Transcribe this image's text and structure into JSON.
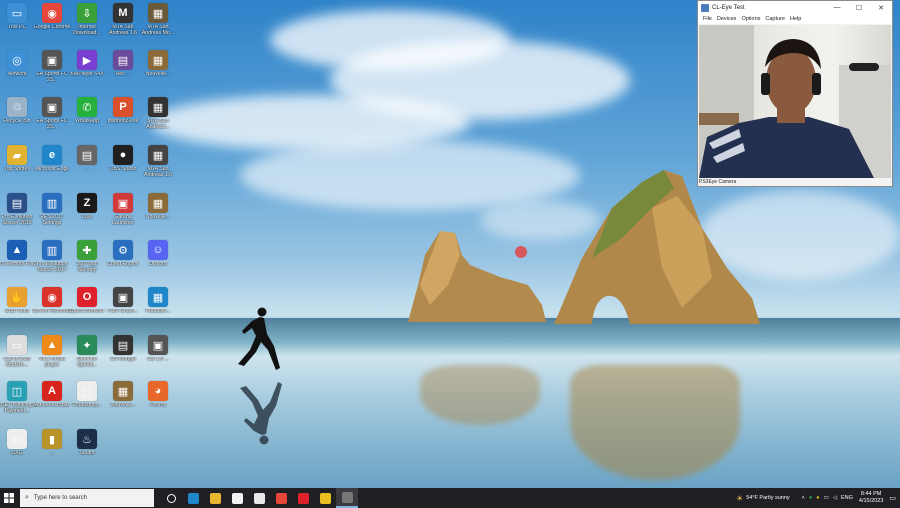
{
  "desktop_icons": [
    {
      "label": "This PC",
      "color": "#3d8fd6",
      "glyph": "▭"
    },
    {
      "label": "Google Chrome",
      "color": "#e6473a",
      "glyph": "◉"
    },
    {
      "label": "Internet Download...",
      "color": "#3aa13a",
      "glyph": "⇩"
    },
    {
      "label": "MTA San Andreas 1.6",
      "color": "#333333",
      "glyph": "M"
    },
    {
      "label": "MTA San Andreas Mo...",
      "color": "#6b5a3a",
      "glyph": "▦"
    },
    {
      "label": "Network",
      "color": "#3d8fd6",
      "glyph": "◎"
    },
    {
      "label": "EA Sports FC 23...",
      "color": "#555555",
      "glyph": "▣"
    },
    {
      "label": "KMPlayer 64X",
      "color": "#7a3fd1",
      "glyph": "▶"
    },
    {
      "label": "Rec ...",
      "color": "#6a4a9a",
      "glyph": "▤"
    },
    {
      "label": "Nouvelle...",
      "color": "#8b6b3a",
      "glyph": "▦"
    },
    {
      "label": "Recycle Bin",
      "color": "#9ab3c9",
      "glyph": "♲"
    },
    {
      "label": "EA Sports FC 23...",
      "color": "#555555",
      "glyph": "▣"
    },
    {
      "label": "WhatsApp",
      "color": "#25b13c",
      "glyph": "✆"
    },
    {
      "label": "psiphon3.exe",
      "color": "#d9502a",
      "glyph": "P"
    },
    {
      "label": "MTA San Andreas...",
      "color": "#333333",
      "glyph": "▦"
    },
    {
      "label": "Top Sprites",
      "color": "#e0b430",
      "glyph": "▰"
    },
    {
      "label": "Microsoft Edge",
      "color": "#1f86c9",
      "glyph": "e"
    },
    {
      "label": "...",
      "color": "#666666",
      "glyph": "▤"
    },
    {
      "label": "OBS Studio",
      "color": "#202020",
      "glyph": "●"
    },
    {
      "label": "MTA San Andreas 1.6",
      "color": "#444444",
      "glyph": "▦"
    },
    {
      "label": "Pro Evolution Soccer 2019",
      "color": "#2a4f8a",
      "glyph": "▤"
    },
    {
      "label": "PES 2017 Settings",
      "color": "#2a6fbf",
      "glyph": "▥"
    },
    {
      "label": "Zula",
      "color": "#1a1a1a",
      "glyph": "Z"
    },
    {
      "label": "Garena Launcher",
      "color": "#d23a3a",
      "glyph": "▣"
    },
    {
      "label": "Nouvelle...",
      "color": "#8b6b3a",
      "glyph": "▦"
    },
    {
      "label": "PS Remote Play",
      "color": "#1b5fb4",
      "glyph": "▲"
    },
    {
      "label": "Pro Evolution Soccer 2017",
      "color": "#2a6fbf",
      "glyph": "▥"
    },
    {
      "label": "360 Total Security",
      "color": "#3aa13a",
      "glyph": "✚"
    },
    {
      "label": "Cheat Engine",
      "color": "#2a6fbf",
      "glyph": "⚙"
    },
    {
      "label": "Discord",
      "color": "#5865f2",
      "glyph": "☺"
    },
    {
      "label": "ESB Tools",
      "color": "#e8a030",
      "glyph": "✋"
    },
    {
      "label": "Screen Recorder",
      "color": "#d9322a",
      "glyph": "◉"
    },
    {
      "label": "Opera Browser",
      "color": "#e0202a",
      "glyph": "O"
    },
    {
      "label": "Pure Crack...",
      "color": "#444444",
      "glyph": "▣"
    },
    {
      "label": "Paradise...",
      "color": "#1f86c9",
      "glyph": "▦"
    },
    {
      "label": "Call of Duty Modern...",
      "color": "#dddddd",
      "glyph": "▭"
    },
    {
      "label": "VLC media player",
      "color": "#f08a1c",
      "glyph": "▲"
    },
    {
      "label": "Need for Speed...",
      "color": "#2a8a5a",
      "glyph": "✦"
    },
    {
      "label": "CS Mongol",
      "color": "#333333",
      "glyph": "▤"
    },
    {
      "label": "CS 1.6 ...",
      "color": "#555555",
      "glyph": "▣"
    },
    {
      "label": "ESET Banking & Payment...",
      "color": "#2aa0b4",
      "glyph": "◫"
    },
    {
      "label": "Adobe Acrobat",
      "color": "#d6231c",
      "glyph": "A"
    },
    {
      "label": "Photoshop...",
      "color": "#eeeeee",
      "glyph": "▢"
    },
    {
      "label": "Nouvelle...",
      "color": "#8b6b3a",
      "glyph": "▦"
    },
    {
      "label": "Firefox",
      "color": "#e8672a",
      "glyph": "◕"
    },
    {
      "label": "DXG",
      "color": "#eeeeee",
      "glyph": "▭"
    },
    {
      "label": "...",
      "color": "#b8932a",
      "glyph": "▮"
    },
    {
      "label": "Steam",
      "color": "#1b2f4a",
      "glyph": "♨"
    }
  ],
  "cam_window": {
    "title": "CL-Eye Test",
    "menu": [
      "File",
      "Devices",
      "Options",
      "Capture",
      "Help"
    ],
    "status": "PS3Eye Camera",
    "minimize": "—",
    "maximize": "☐",
    "close": "✕"
  },
  "taskbar": {
    "search_placeholder": "Type here to search",
    "apps": [
      {
        "name": "task-view",
        "color": "#ffffff"
      },
      {
        "name": "edge",
        "color": "#1f86c9"
      },
      {
        "name": "file-explorer",
        "color": "#e8b830"
      },
      {
        "name": "store",
        "color": "#f2f2f2"
      },
      {
        "name": "mail",
        "color": "#e8e8e8"
      },
      {
        "name": "chrome",
        "color": "#e6473a"
      },
      {
        "name": "opera",
        "color": "#e0202a"
      },
      {
        "name": "zula",
        "color": "#e8c020"
      },
      {
        "name": "cl-eye",
        "color": "#777777"
      }
    ],
    "weather": "54°F  Partly sunny",
    "lang": "ENG",
    "time": "8:44 PM",
    "date": "4/15/2023"
  }
}
